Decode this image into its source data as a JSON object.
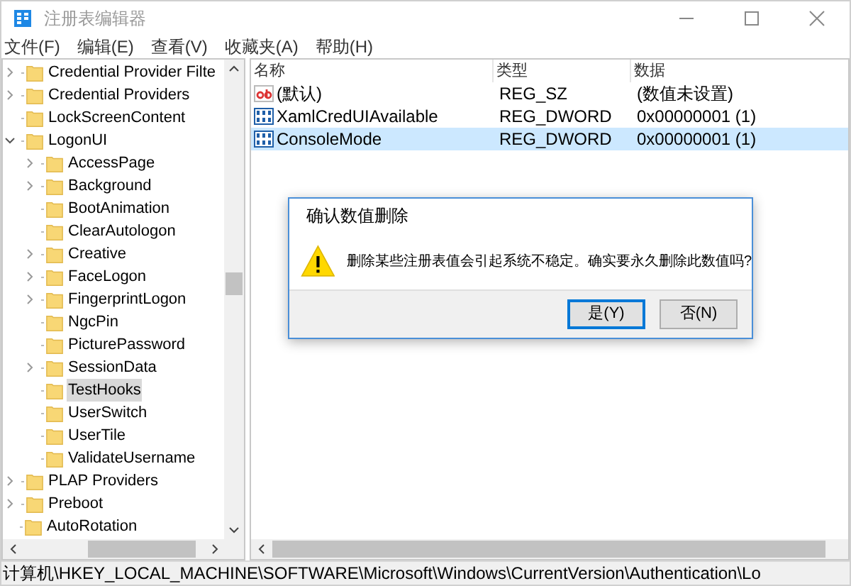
{
  "window": {
    "title": "注册表编辑器"
  },
  "menu": [
    "文件(F)",
    "编辑(E)",
    "查看(V)",
    "收藏夹(A)",
    "帮助(H)"
  ],
  "tree": [
    {
      "children": [
        {
          "label": "Credential Provider Filte",
          "expanded": false,
          "selected": false
        },
        {
          "label": "Credential Providers",
          "expanded": false,
          "selected": false
        },
        {
          "label": "LockScreenContent",
          "selected": false
        },
        {
          "label": "LogonUI",
          "expanded": true,
          "selected": false,
          "children": [
            {
              "label": "AccessPage",
              "expanded": false,
              "selected": false
            },
            {
              "label": "Background",
              "expanded": false,
              "selected": false
            },
            {
              "label": "BootAnimation",
              "selected": false
            },
            {
              "label": "ClearAutologon",
              "selected": false
            },
            {
              "label": "Creative",
              "expanded": false,
              "selected": false
            },
            {
              "label": "FaceLogon",
              "expanded": false,
              "selected": false
            },
            {
              "label": "FingerprintLogon",
              "expanded": false,
              "selected": false
            },
            {
              "label": "NgcPin",
              "selected": false
            },
            {
              "label": "PicturePassword",
              "selected": false
            },
            {
              "label": "SessionData",
              "expanded": false,
              "selected": false
            },
            {
              "label": "TestHooks",
              "selected": true
            },
            {
              "label": "UserSwitch",
              "selected": false
            },
            {
              "label": "UserTile",
              "selected": false
            },
            {
              "label": "ValidateUsername",
              "selected": false
            }
          ]
        },
        {
          "label": "PLAP Providers",
          "expanded": false,
          "selected": false
        },
        {
          "label": "Preboot",
          "expanded": false,
          "selected": false
        }
      ]
    },
    {
      "label": "AutoRotation",
      "selected": false
    }
  ],
  "table": {
    "columns": [
      "名称",
      "类型",
      "数据"
    ],
    "rows": [
      {
        "kind": "string",
        "name": "(默认)",
        "type": "REG_SZ",
        "data": "(数值未设置)",
        "selected": false
      },
      {
        "kind": "dword",
        "name": "XamlCredUIAvailable",
        "type": "REG_DWORD",
        "data": "0x00000001 (1)",
        "selected": false
      },
      {
        "kind": "dword",
        "name": "ConsoleMode",
        "type": "REG_DWORD",
        "data": "0x00000001 (1)",
        "selected": true
      }
    ]
  },
  "dialog": {
    "title": "确认数值删除",
    "message": "删除某些注册表值会引起系统不稳定。确实要永久删除此数值吗?",
    "buttons": [
      {
        "label": "是(Y)",
        "default": true
      },
      {
        "label": "否(N)",
        "default": false
      }
    ]
  },
  "status_bar": "计算机\\HKEY_LOCAL_MACHINE\\SOFTWARE\\Microsoft\\Windows\\CurrentVersion\\Authentication\\Lo"
}
